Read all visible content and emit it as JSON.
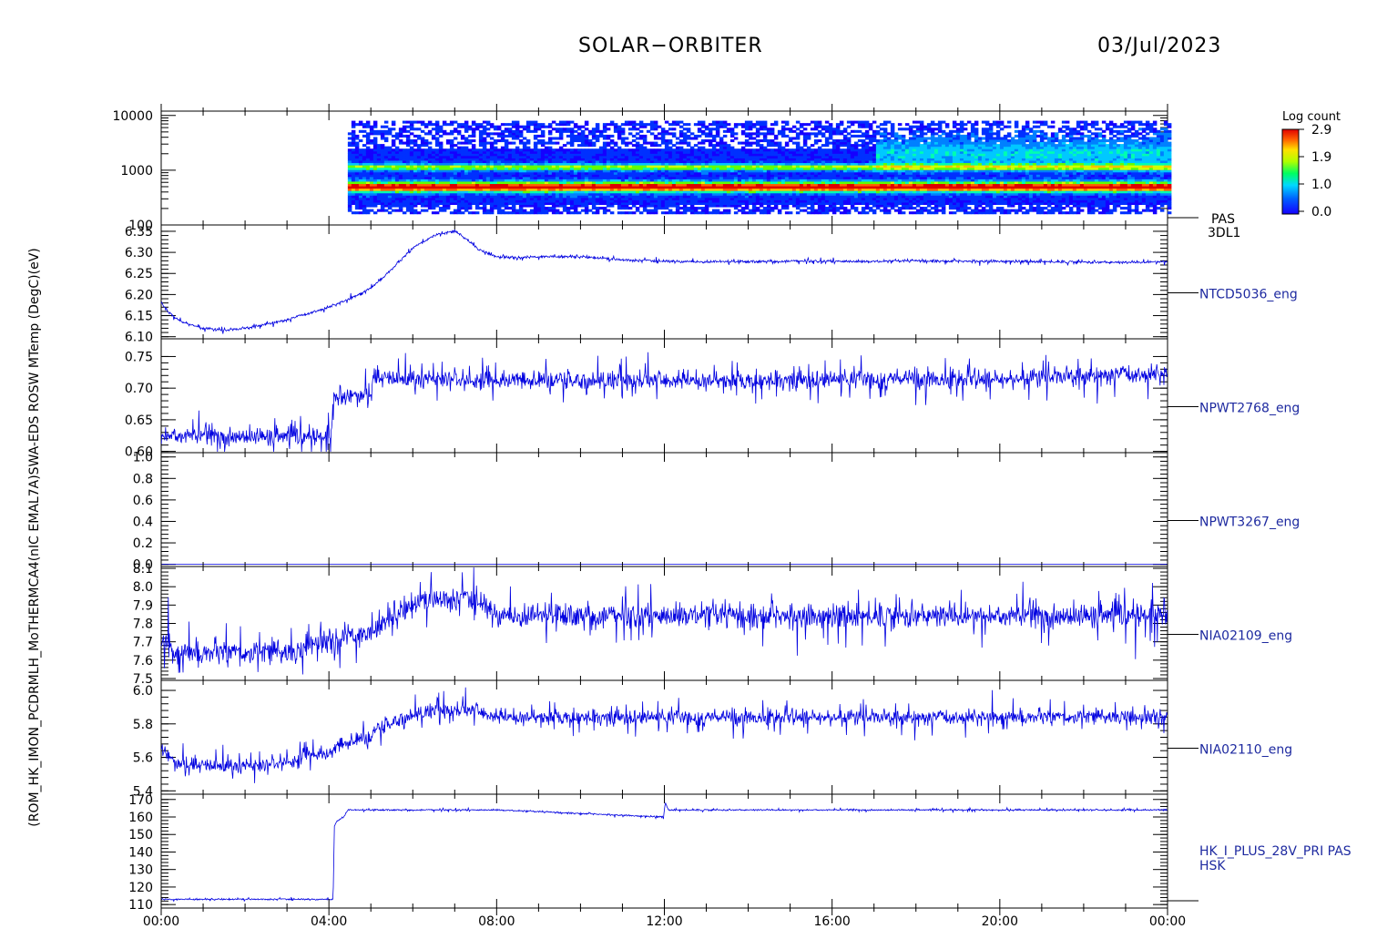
{
  "header": {
    "mission": "SOLAR−ORBITER",
    "date": "03/Jul/2023"
  },
  "colorbar": {
    "title": "Log count",
    "ticks": [
      "2.9",
      "1.9",
      "1.0",
      "0.0"
    ]
  },
  "left_axis_text": "(ROM_HK_IMON_PCDRMLH_MoTHERMCA4(nIC EMAL7A)SWA-EDS ROSW MTemp (DegC)(eV)",
  "colors": {
    "trace": "#0000e0",
    "axis": "#000000"
  },
  "x_ticks": [
    "00:00",
    "04:00",
    "08:00",
    "12:00",
    "16:00",
    "20:00",
    "00:00"
  ],
  "chart_data": [
    {
      "type": "heatmap",
      "log_scale": true,
      "y_ticks": [
        "10000",
        "1000",
        "100"
      ],
      "ylim": [
        100,
        12000
      ],
      "right_label": "PAS",
      "right_label2": "3DL1",
      "bands_ev": [
        500,
        1150
      ],
      "data_start_hour": 4.45
    },
    {
      "type": "line",
      "y_ticks": [
        "6.35",
        "6.30",
        "6.25",
        "6.20",
        "6.15",
        "6.10"
      ],
      "ylim": [
        6.095,
        6.365
      ],
      "right_label": "NTCD5036_eng",
      "x": [
        0,
        0.2,
        0.5,
        1,
        1.5,
        2,
        2.5,
        3,
        3.5,
        4,
        4.5,
        5,
        5.5,
        6,
        6.5,
        7,
        7.3,
        7.6,
        8,
        8.5,
        9,
        10,
        11,
        12,
        13,
        14,
        15,
        16,
        17,
        18,
        19,
        20,
        21,
        22,
        23,
        24
      ],
      "values": [
        6.18,
        6.155,
        6.135,
        6.12,
        6.115,
        6.12,
        6.13,
        6.14,
        6.155,
        6.17,
        6.19,
        6.215,
        6.26,
        6.31,
        6.34,
        6.35,
        6.33,
        6.305,
        6.29,
        6.287,
        6.29,
        6.29,
        6.282,
        6.279,
        6.278,
        6.278,
        6.279,
        6.279,
        6.278,
        6.28,
        6.279,
        6.279,
        6.278,
        6.277,
        6.276,
        6.278
      ],
      "noise": 0.003
    },
    {
      "type": "line",
      "y_ticks": [
        "0.75",
        "0.70",
        "0.65",
        "0.60"
      ],
      "ylim": [
        0.598,
        0.778
      ],
      "right_label": "NPWT2768_eng",
      "x": [
        0,
        4.05,
        4.1,
        4.35,
        4.5,
        5.0,
        5.05,
        6,
        8,
        10,
        12,
        14,
        16,
        18,
        20,
        22,
        23,
        24
      ],
      "values": [
        0.625,
        0.622,
        0.68,
        0.685,
        0.69,
        0.69,
        0.715,
        0.715,
        0.712,
        0.712,
        0.712,
        0.712,
        0.714,
        0.715,
        0.714,
        0.72,
        0.722,
        0.722
      ],
      "noise": 0.013
    },
    {
      "type": "line",
      "y_ticks": [
        "1.0",
        "0.8",
        "0.6",
        "0.4",
        "0.2",
        "0.0"
      ],
      "ylim": [
        -0.02,
        1.04
      ],
      "right_label": "NPWT3267_eng",
      "x": [
        0,
        24
      ],
      "values": [
        0.0,
        0.0
      ],
      "noise": 0
    },
    {
      "type": "line",
      "y_ticks": [
        "8.1",
        "8.0",
        "7.9",
        "7.8",
        "7.7",
        "7.6",
        "7.5"
      ],
      "ylim": [
        7.49,
        8.11
      ],
      "right_label": "NIA02109_eng",
      "x": [
        0,
        0.2,
        0.25,
        3.4,
        3.45,
        4.3,
        4.35,
        5.0,
        5.1,
        5.6,
        6.0,
        6.4,
        7.5,
        8.0,
        10,
        12,
        14,
        16,
        18,
        20,
        22,
        24
      ],
      "values": [
        7.7,
        7.7,
        7.64,
        7.64,
        7.7,
        7.7,
        7.74,
        7.74,
        7.78,
        7.85,
        7.9,
        7.93,
        7.93,
        7.85,
        7.84,
        7.84,
        7.84,
        7.84,
        7.84,
        7.84,
        7.84,
        7.84
      ],
      "noise": 0.06
    },
    {
      "type": "line",
      "y_ticks": [
        "6.0",
        "5.8",
        "5.6",
        "5.4"
      ],
      "ylim": [
        5.38,
        6.06
      ],
      "right_label": "NIA02110_eng",
      "x": [
        0,
        0.3,
        0.6,
        2.5,
        3.0,
        3.3,
        3.4,
        4.1,
        4.2,
        4.6,
        5.0,
        5.1,
        5.8,
        6.5,
        7.5,
        8.0,
        10,
        12,
        14,
        16,
        18,
        20,
        22,
        24
      ],
      "values": [
        5.66,
        5.58,
        5.55,
        5.55,
        5.58,
        5.58,
        5.62,
        5.62,
        5.67,
        5.7,
        5.72,
        5.76,
        5.84,
        5.88,
        5.88,
        5.84,
        5.84,
        5.84,
        5.84,
        5.84,
        5.84,
        5.84,
        5.84,
        5.84
      ],
      "noise": 0.04
    },
    {
      "type": "line",
      "y_ticks": [
        "170",
        "160",
        "150",
        "140",
        "130",
        "120",
        "110"
      ],
      "ylim": [
        108,
        173
      ],
      "right_label": "HK_I_PLUS_28V_PRI PAS",
      "right_label2": "HSK",
      "x": [
        0,
        4.1,
        4.13,
        4.2,
        4.35,
        4.45,
        4.55,
        8,
        11.98,
        12.02,
        12.1,
        12.15,
        16,
        20,
        24
      ],
      "values": [
        113,
        113,
        155,
        158,
        160,
        164,
        164,
        164,
        160,
        168,
        164,
        164,
        164,
        164,
        164
      ],
      "noise": 0.4
    }
  ]
}
